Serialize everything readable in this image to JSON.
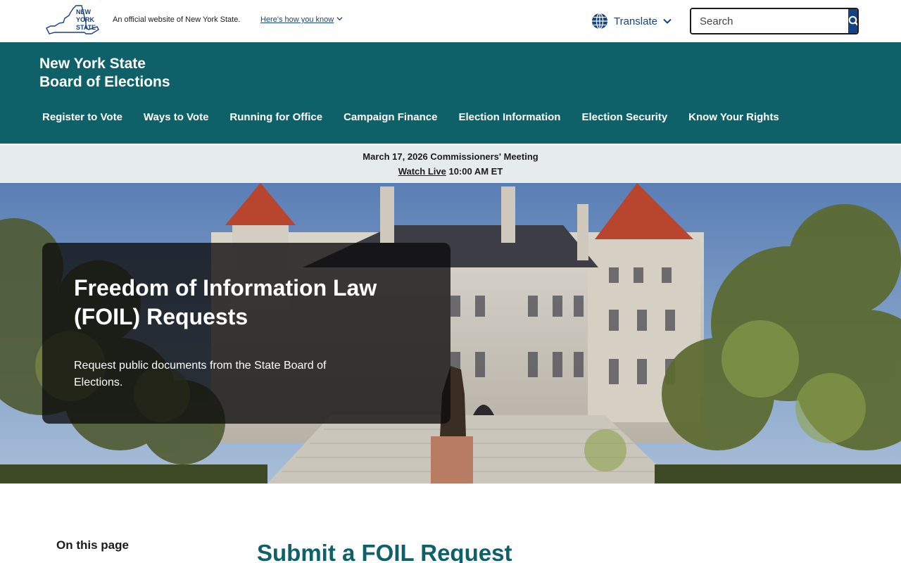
{
  "topbar": {
    "logo_text": "NEW YORK STATE",
    "official_text": "An official website of New York State.",
    "how_link": "Here's how you know",
    "translate_label": "Translate",
    "search_placeholder": "Search"
  },
  "agency": {
    "name_line1": "New York State",
    "name_line2": "Board of Elections"
  },
  "nav": {
    "items": [
      "Register to Vote",
      "Ways to Vote",
      "Running for Office",
      "Campaign Finance",
      "Election Information",
      "Election Security",
      "Know Your Rights"
    ]
  },
  "alert": {
    "title": "March 17, 2026 Commissioners' Meeting",
    "watch_link": "Watch Live",
    "time": "10:00 AM ET"
  },
  "hero": {
    "title": "Freedom of Information Law (FOIL) Requests",
    "description": "Request public documents from the State Board of Elections."
  },
  "content": {
    "on_this_page": "On this page",
    "section_title": "Submit a FOIL Request"
  },
  "colors": {
    "agency_teal": "#0e6168",
    "nys_blue": "#154285",
    "alert_bg": "#e5eceb"
  },
  "icons": [
    "nys-logo-icon",
    "chevron-down-icon",
    "globe-icon",
    "search-icon"
  ]
}
